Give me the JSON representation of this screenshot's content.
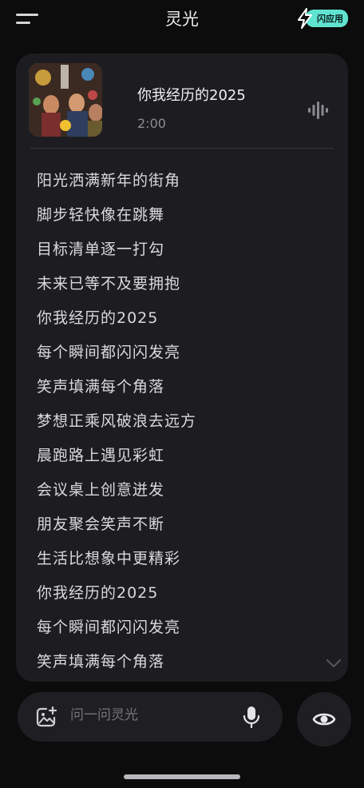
{
  "header": {
    "title": "灵光",
    "badge_label": "闪应用",
    "menu_icon": "hamburger-menu-icon"
  },
  "song": {
    "title": "你我经历的2025",
    "duration": "2:00",
    "cover_icon": "album-cover-image",
    "wave_icon": "audio-wave-icon"
  },
  "lyrics": [
    "阳光洒满新年的街角",
    "脚步轻快像在跳舞",
    "目标清单逐一打勾",
    "未来已等不及要拥抱",
    "你我经历的2025",
    "每个瞬间都闪闪发亮",
    "笑声填满每个角落",
    "梦想正乘风破浪去远方",
    "晨跑路上遇见彩虹",
    "会议桌上创意迸发",
    "朋友聚会笑声不断",
    "生活比想象中更精彩",
    "你我经历的2025",
    "每个瞬间都闪闪发亮",
    "笑声填满每个角落"
  ],
  "input": {
    "placeholder": "问一问灵光",
    "add_icon": "image-add-icon",
    "mic_icon": "microphone-icon"
  },
  "actions": {
    "eye_icon": "eye-icon"
  },
  "colors": {
    "background": "#0c0c0d",
    "card": "#1d1d21",
    "accent": "#5fe3d0"
  }
}
